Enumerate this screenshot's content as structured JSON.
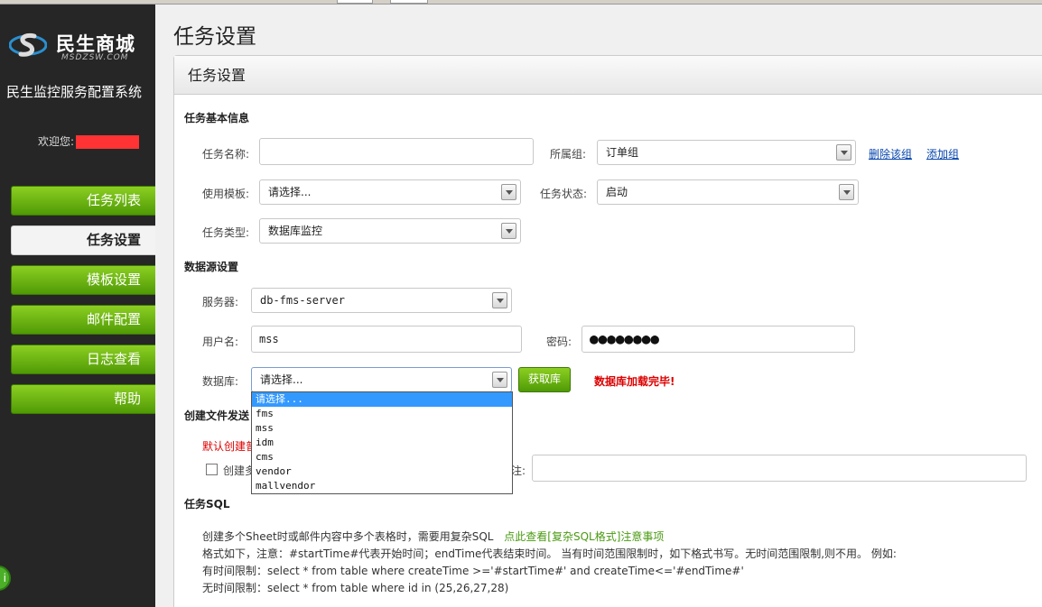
{
  "sidebar": {
    "brand": "民生商城",
    "brand_sub": "MSDZSW.COM",
    "system_title": "民生监控服务配置系统",
    "welcome_label": "欢迎您:",
    "nav": [
      {
        "label": "任务列表"
      },
      {
        "label": "任务设置",
        "active": true
      },
      {
        "label": "模板设置"
      },
      {
        "label": "邮件配置"
      },
      {
        "label": "日志查看"
      },
      {
        "label": "帮助"
      }
    ]
  },
  "main": {
    "page_title": "任务设置",
    "panel_title": "任务设置",
    "basic": {
      "title": "任务基本信息",
      "task_name_label": "任务名称:",
      "task_name_value": "",
      "group_label": "所属组:",
      "group_value": "订单组",
      "delete_group": "删除该组",
      "add_group": "添加组",
      "template_label": "使用模板:",
      "template_value": "请选择...",
      "status_label": "任务状态:",
      "status_value": "启动",
      "type_label": "任务类型:",
      "type_value": "数据库监控"
    },
    "datasource": {
      "title": "数据源设置",
      "server_label": "服务器:",
      "server_value": "db-fms-server",
      "user_label": "用户名:",
      "user_value": "mss",
      "password_label": "密码:",
      "password_value": "●●●●●●●●",
      "db_label": "数据库:",
      "db_value": "请选择...",
      "fetch_button": "获取库",
      "status_msg": "数据库加载完毕!",
      "db_options": [
        "请选择...",
        "fms",
        "mss",
        "idm",
        "cms",
        "vendor",
        "mallvendor"
      ]
    },
    "file": {
      "title": "创建文件发送",
      "red_note": "默认创建普",
      "checkbox_label": "创建多",
      "field_label": "注:",
      "field_value": ""
    },
    "sql": {
      "title": "任务SQL",
      "line1": "创建多个Sheet时或邮件内容中多个表格时，需要用复杂SQL",
      "line1_link": "点此查看[复杂SQL格式]注意事项",
      "line2": "格式如下，注意：#startTime#代表开始时间；endTime代表结束时间。 当有时间范围限制时，如下格式书写。无时间范围限制,则不用。 例如:",
      "line3": "有时间限制：select * from table where createTime >='#startTime#' and createTime<='#endTime#'",
      "line4": "无时间限制：select * from table where id in (25,26,27,28)"
    }
  },
  "colors": {
    "accent_green": "#5aa80c",
    "sidebar_bg": "#262626",
    "link_blue": "#0645ad",
    "error_red": "#dd0000",
    "selection_blue": "#3399ff"
  }
}
